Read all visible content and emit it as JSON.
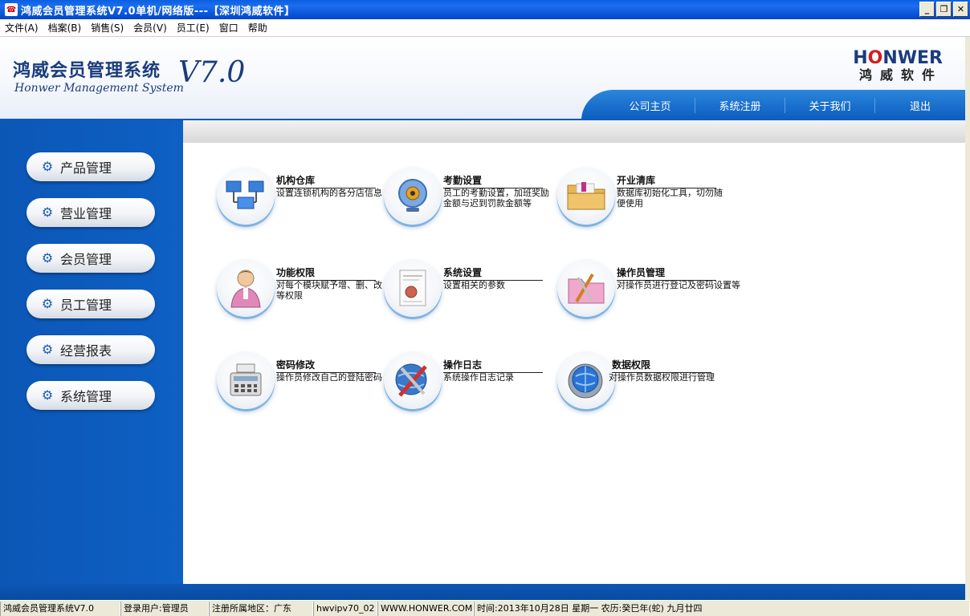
{
  "window": {
    "title": "鸿威会员管理系统V7.0单机/网络版---【深圳鸿威软件】",
    "minimize": "_",
    "restore": "❐",
    "close": "✕"
  },
  "menu": [
    {
      "label": "文件(A)"
    },
    {
      "label": "档案(B)"
    },
    {
      "label": "销售(S)"
    },
    {
      "label": "会员(V)"
    },
    {
      "label": "员工(E)"
    },
    {
      "label": "窗口"
    },
    {
      "label": "帮助"
    }
  ],
  "header": {
    "brand_cn": "鸿威会员管理系统",
    "brand_en": "Honwer Management System",
    "version": "V7.0",
    "logo_en_h": "H",
    "logo_en_o": "O",
    "logo_en_rest": "NWER",
    "logo_cn": "鸿威软件",
    "nav": [
      {
        "label": "公司主页"
      },
      {
        "label": "系统注册"
      },
      {
        "label": "关于我们"
      },
      {
        "label": "退出"
      }
    ]
  },
  "sidebar": {
    "items": [
      {
        "label": "产品管理"
      },
      {
        "label": "营业管理"
      },
      {
        "label": "会员管理"
      },
      {
        "label": "员工管理"
      },
      {
        "label": "经营报表"
      },
      {
        "label": "系统管理"
      }
    ]
  },
  "tiles": [
    {
      "title": "机构仓库",
      "desc": "设置连锁机构的各分店信息",
      "icon": "network-computers-icon"
    },
    {
      "title": "考勤设置",
      "desc": "员工的考勤设置，加班奖励金额与迟到罚款金额等",
      "icon": "webcam-icon"
    },
    {
      "title": "开业清库",
      "desc": "数据库初始化工具，切勿随便使用",
      "icon": "folder-icon"
    },
    {
      "title": "功能权限",
      "desc": "对每个模块赋予增、删、改等权限",
      "icon": "user-person-icon"
    },
    {
      "title": "系统设置",
      "desc": "设置相关的参数",
      "icon": "document-settings-icon"
    },
    {
      "title": "操作员管理",
      "desc": "对操作员进行登记及密码设置等",
      "icon": "tools-folder-icon"
    },
    {
      "title": "密码修改",
      "desc": "操作员修改自己的登陆密码",
      "icon": "cash-register-icon"
    },
    {
      "title": "操作日志",
      "desc": "系统操作日志记录",
      "icon": "globe-tools-icon"
    },
    {
      "title": "数据权限",
      "desc": "对操作员数据权限进行管理",
      "icon": "globe-gear-icon"
    }
  ],
  "status": {
    "app": "鸿威会员管理系统V7.0",
    "user": "登录用户:管理员",
    "region": "注册所属地区：广东",
    "code": "hwvipv70_02",
    "site": "WWW.HONWER.COM",
    "time": "时间:2013年10月28日   星期一   农历:癸巳年(蛇) 九月廿四"
  },
  "colors": {
    "accent_blue": "#0d58b8",
    "title_blue": "#1a3c7c",
    "logo_red": "#d02020"
  }
}
